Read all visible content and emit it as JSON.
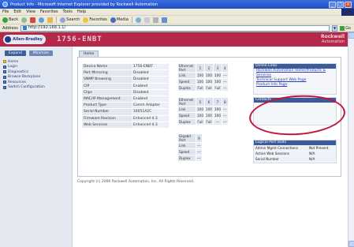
{
  "window": {
    "title": "Product Info - Microsoft Internet Explorer provided by Rockwell Automation",
    "menu": [
      "File",
      "Edit",
      "View",
      "Favorites",
      "Tools",
      "Help"
    ],
    "toolbar": {
      "back": "Back",
      "search": "Search",
      "favorites": "Favorites",
      "media": "Media"
    },
    "address_label": "Address",
    "address_value": "http://192.168.1.1/",
    "go_label": "Go"
  },
  "banner": {
    "logo_text": "Allen-Bradley",
    "product": "1756-ENBT",
    "brand_line1": "Rockwell",
    "brand_line2": "Automation"
  },
  "nav": {
    "tabs": [
      "Expand",
      "Minimize"
    ],
    "items": [
      "Home",
      "Login",
      "Diagnostics",
      "Browse Backplane",
      "Resources",
      "Switch Configuration"
    ]
  },
  "main": {
    "tab": "Home",
    "info_rows": [
      [
        "Device Name",
        "1756-ENBT"
      ],
      [
        "Port Mirroring",
        "Disabled"
      ],
      [
        "SNMP Browsing",
        "Disabled"
      ],
      [
        "CIP",
        "Enabled"
      ],
      [
        "Clips",
        "Disabled"
      ],
      [
        "MAC/IP Management",
        "Enabled"
      ],
      [
        "Product Type",
        "Comm Adapter"
      ],
      [
        "Serial Number",
        "10051A2C"
      ],
      [
        "Firmware Revision",
        "Enhanced 4.3"
      ],
      [
        "Web Services",
        "Enhanced 4.3"
      ]
    ],
    "stats_a": {
      "header": [
        "Ethernet Port",
        "1",
        "2",
        "3",
        "4"
      ],
      "rows": [
        [
          "Link",
          "100",
          "100",
          "100",
          "---"
        ],
        [
          "Speed",
          "100",
          "100",
          "100",
          "---"
        ],
        [
          "Duplex",
          "Full",
          "Full",
          "Full",
          "---"
        ]
      ]
    },
    "stats_b": {
      "header": [
        "Ethernet Port",
        "5",
        "6",
        "7",
        "8"
      ],
      "rows": [
        [
          "Link",
          "100",
          "100",
          "100",
          "---"
        ],
        [
          "Speed",
          "100",
          "100",
          "100",
          "---"
        ],
        [
          "Duplex",
          "Full",
          "Full",
          "---",
          "---"
        ]
      ]
    },
    "stats_c": {
      "header": [
        "Gigabit Port",
        "9"
      ],
      "rows": [
        [
          "Link",
          "---"
        ],
        [
          "Speed",
          "---"
        ],
        [
          "Duplex",
          "---"
        ]
      ]
    },
    "links_head": "Online Links",
    "links": [
      "Rockwell Automation Home/Products & Services",
      "Technical Support Web Page",
      "Product Info Page"
    ],
    "contacts_head": "Contacts",
    "summary_head": "Logical Port Stats",
    "summary_rows": [
      [
        "Admin Mgmt Connections",
        "Not Present"
      ],
      [
        "Active Web Sessions",
        "N/A"
      ],
      [
        "Serial Number",
        "N/A"
      ]
    ],
    "footer": "Copyright (c) 2006 Rockwell Automation, Inc. All Rights Reserved."
  }
}
